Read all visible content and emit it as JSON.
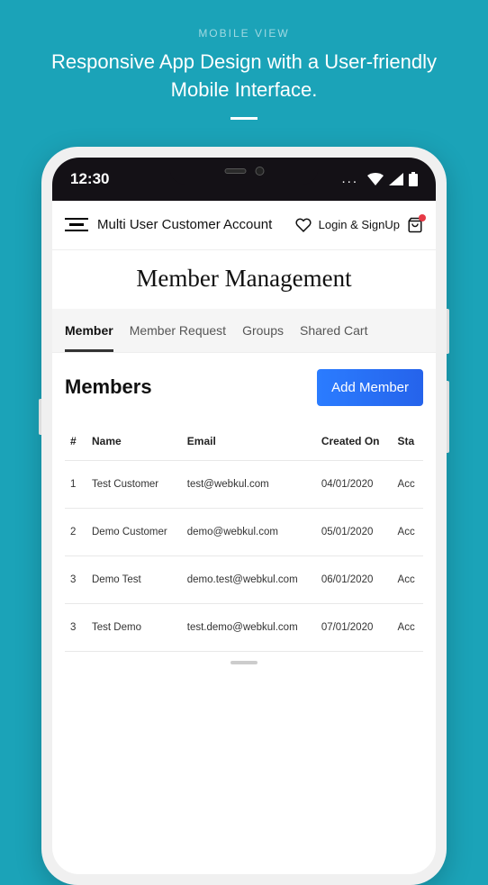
{
  "promo": {
    "label": "MOBILE VIEW",
    "title": "Responsive App Design with a User-friendly Mobile Interface."
  },
  "statusBar": {
    "time": "12:30",
    "dots": "..."
  },
  "header": {
    "title": "Multi User Customer Account",
    "login": "Login & SignUp"
  },
  "page": {
    "title": "Member Management"
  },
  "tabs": [
    {
      "label": "Member",
      "active": true
    },
    {
      "label": "Member Request",
      "active": false
    },
    {
      "label": "Groups",
      "active": false
    },
    {
      "label": "Shared Cart",
      "active": false
    }
  ],
  "section": {
    "title": "Members",
    "addButton": "Add Member"
  },
  "table": {
    "headers": {
      "num": "#",
      "name": "Name",
      "email": "Email",
      "created": "Created On",
      "status": "Sta"
    },
    "rows": [
      {
        "num": "1",
        "name": "Test Customer",
        "email": "test@webkul.com",
        "created": "04/01/2020",
        "status": "Acc"
      },
      {
        "num": "2",
        "name": "Demo Customer",
        "email": "demo@webkul.com",
        "created": "05/01/2020",
        "status": "Acc"
      },
      {
        "num": "3",
        "name": "Demo Test",
        "email": "demo.test@webkul.com",
        "created": "06/01/2020",
        "status": "Acc"
      },
      {
        "num": "3",
        "name": "Test Demo",
        "email": "test.demo@webkul.com",
        "created": "07/01/2020",
        "status": "Acc"
      }
    ]
  }
}
